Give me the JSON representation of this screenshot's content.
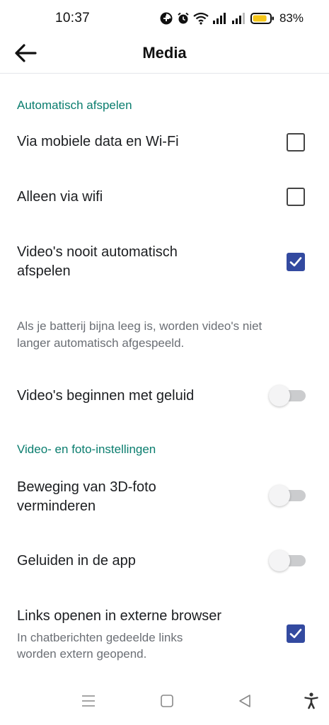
{
  "status_bar": {
    "time": "10:37",
    "battery_text": "83%",
    "battery_level": 0.83,
    "icons": [
      "data-saver-icon",
      "alarm-icon",
      "wifi-icon",
      "signal-icon",
      "signal-icon",
      "battery-icon"
    ]
  },
  "app_bar": {
    "back_icon": "arrow-left-icon",
    "title": "Media"
  },
  "sections": {
    "autoplay": {
      "header": "Automatisch afspelen",
      "via_mobile_data": {
        "label": "Via mobiele data en Wi-Fi",
        "checked": false
      },
      "wifi_only": {
        "label": "Alleen via wifi",
        "checked": false
      },
      "never_autoplay": {
        "label_line1": "Video's nooit automatisch",
        "label_line2": "afspelen",
        "checked": true
      },
      "description_line1": "Als je batterij bijna leeg is, worden video's niet",
      "description_line2": "langer automatisch afgespeeld.",
      "sound_start": {
        "label": "Video's beginnen met geluid",
        "on": false
      }
    },
    "video_photo": {
      "header": "Video- en foto-instellingen",
      "reduce_3d": {
        "label_line1": "Beweging van 3D-foto",
        "label_line2": "verminderen",
        "on": false
      },
      "in_app_sounds": {
        "label": "Geluiden in de app",
        "on": false
      },
      "external_links": {
        "label": "Links openen in externe browser",
        "sub_line1": "In chatberichten gedeelde links",
        "sub_line2": "worden extern geopend.",
        "checked": true
      }
    }
  },
  "nav_bar": {
    "icons": [
      "menu-icon",
      "home-square-icon",
      "back-triangle-icon",
      "accessibility-icon"
    ]
  },
  "colors": {
    "accent_header": "#0a7d6e",
    "checkbox_checked": "#334aa0",
    "toggle_track_off": "#cbccce",
    "battery_fill": "#f5c518"
  }
}
